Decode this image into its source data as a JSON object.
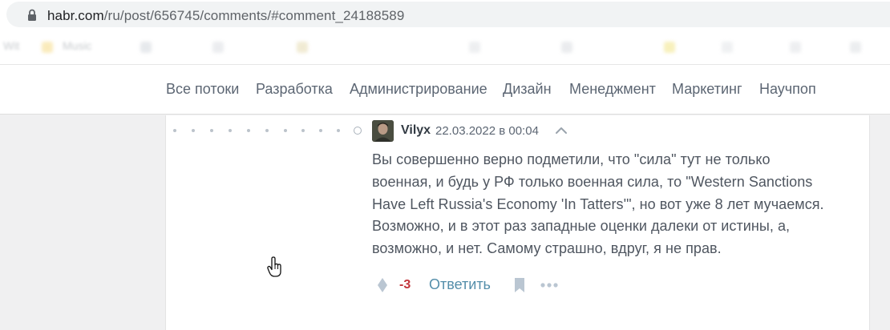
{
  "browser": {
    "url_host": "habr.com",
    "url_path": "/ru/post/656745/comments/#comment_24188589",
    "bookmarks": [
      "Wit",
      "Music"
    ]
  },
  "nav": {
    "items": [
      "Все потоки",
      "Разработка",
      "Администрирование",
      "Дизайн",
      "Менеджмент",
      "Маркетинг",
      "Научпоп"
    ]
  },
  "comment": {
    "author": "Vilyx",
    "date": "22.03.2022 в 00:04",
    "lines": [
      "Вы совершенно верно подметили, что \"сила\" тут не только",
      "военная, и будь у РФ только военная сила, то \"Western Sanctions",
      "Have Left Russia's Economy 'In Tatters'\", но вот уже 8 лет мучаемся.",
      "Возможно, и в этот раз западные оценки далеки от истины, а,",
      "возможно, и нет. Самому страшно, вдруг, я не прав."
    ],
    "score": "-3",
    "reply_label": "Ответить"
  },
  "icons": {
    "lock": "lock-icon",
    "collapse": "chevron-up-icon",
    "vote": "vote-icon",
    "bookmark": "bookmark-icon",
    "more": "more-icon",
    "cursor": "hand-cursor-icon"
  },
  "colors": {
    "score_negative": "#c3353b",
    "reply_link": "#548eaa",
    "text": "#4f5660"
  }
}
